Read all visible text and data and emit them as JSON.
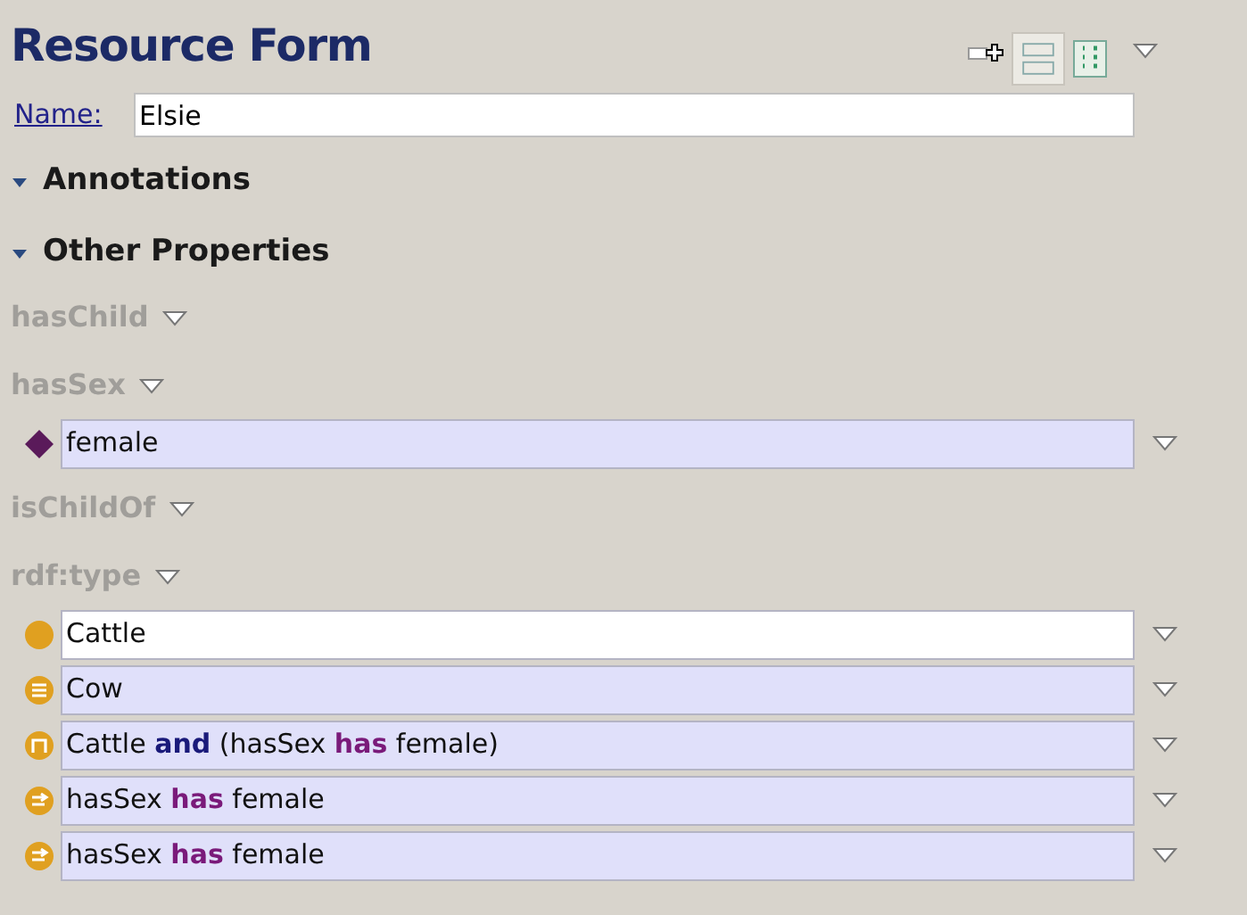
{
  "title": "Resource Form",
  "name_field": {
    "label": "Name:",
    "value": "Elsie"
  },
  "sections": [
    {
      "label": "Annotations",
      "expanded": true
    },
    {
      "label": "Other Properties",
      "expanded": true
    }
  ],
  "properties": [
    {
      "name": "hasChild"
    },
    {
      "name": "hasSex",
      "values": [
        {
          "kind": "individual",
          "selected": false,
          "parts": [
            {
              "text": "female"
            }
          ]
        }
      ]
    },
    {
      "name": "isChildOf"
    },
    {
      "name": "rdf:type",
      "values": [
        {
          "kind": "class",
          "selected": true,
          "parts": [
            {
              "text": "Cattle"
            }
          ]
        },
        {
          "kind": "equivalent",
          "selected": false,
          "parts": [
            {
              "text": "Cow"
            }
          ]
        },
        {
          "kind": "intersection",
          "selected": false,
          "parts": [
            {
              "text": "Cattle "
            },
            {
              "text": "and",
              "color": "#1a1a7a"
            },
            {
              "text": " (hasSex "
            },
            {
              "text": "has",
              "color": "#7a1a7a"
            },
            {
              "text": " female)"
            }
          ]
        },
        {
          "kind": "restriction",
          "selected": false,
          "parts": [
            {
              "text": "hasSex "
            },
            {
              "text": "has",
              "color": "#7a1a7a"
            },
            {
              "text": " female"
            }
          ]
        },
        {
          "kind": "restriction",
          "selected": false,
          "parts": [
            {
              "text": "hasSex "
            },
            {
              "text": "has",
              "color": "#7a1a7a"
            },
            {
              "text": " female"
            }
          ]
        }
      ]
    }
  ]
}
